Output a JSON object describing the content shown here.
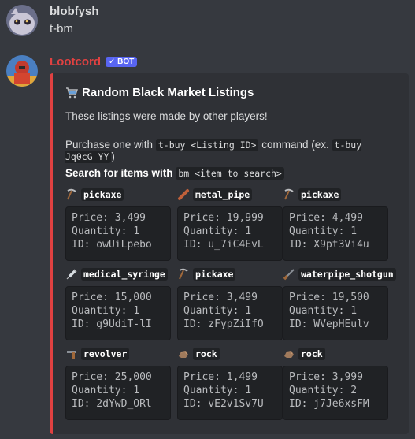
{
  "messages": [
    {
      "username": "blobfysh",
      "username_color": "#f04747",
      "content": "t-bm"
    },
    {
      "username": "Lootcord",
      "username_color": "#e04141",
      "badge": "✓ BOT"
    }
  ],
  "embed": {
    "accent_color": "#e04141",
    "title": "Random Black Market Listings",
    "title_icon": "shopping-cart-icon",
    "description": "These listings were made by other players!",
    "purchase": {
      "pre": "Purchase one with",
      "code1": "t-buy <Listing ID>",
      "mid": "command (ex.",
      "code2": "t-buy Jq0cG_YY",
      "post": ")"
    },
    "search": {
      "pre": "Search for items with",
      "code": "bm <item to search>"
    },
    "listings": [
      {
        "item": "pickaxe",
        "icon": "pickaxe-icon",
        "price": "Price: 3,499",
        "quantity": "Quantity: 1",
        "id": "ID: owUiLpebo"
      },
      {
        "item": "metal_pipe",
        "icon": "metal-pipe-icon",
        "price": "Price: 19,999",
        "quantity": "Quantity: 1",
        "id": "ID: u_7iC4EvL"
      },
      {
        "item": "pickaxe",
        "icon": "pickaxe-icon",
        "price": "Price: 4,499",
        "quantity": "Quantity: 1",
        "id": "ID: X9pt3Vi4u"
      },
      {
        "item": "medical_syringe",
        "icon": "syringe-icon",
        "price": "Price: 15,000",
        "quantity": "Quantity: 1",
        "id": "ID: g9UdiT-lI"
      },
      {
        "item": "pickaxe",
        "icon": "pickaxe-icon",
        "price": "Price: 3,499",
        "quantity": "Quantity: 1",
        "id": "ID: zFypZiIfO"
      },
      {
        "item": "waterpipe_shotgun",
        "icon": "shotgun-icon",
        "price": "Price: 19,500",
        "quantity": "Quantity: 1",
        "id": "ID: WVepHEulv"
      },
      {
        "item": "revolver",
        "icon": "revolver-icon",
        "price": "Price: 25,000",
        "quantity": "Quantity: 1",
        "id": "ID: 2dYwD_ORl"
      },
      {
        "item": "rock",
        "icon": "rock-icon",
        "price": "Price: 1,499",
        "quantity": "Quantity: 1",
        "id": "ID: vE2v1Sv7U"
      },
      {
        "item": "rock",
        "icon": "rock-icon",
        "price": "Price: 3,999",
        "quantity": "Quantity: 2",
        "id": "ID: j7Je6xsFM"
      }
    ]
  }
}
